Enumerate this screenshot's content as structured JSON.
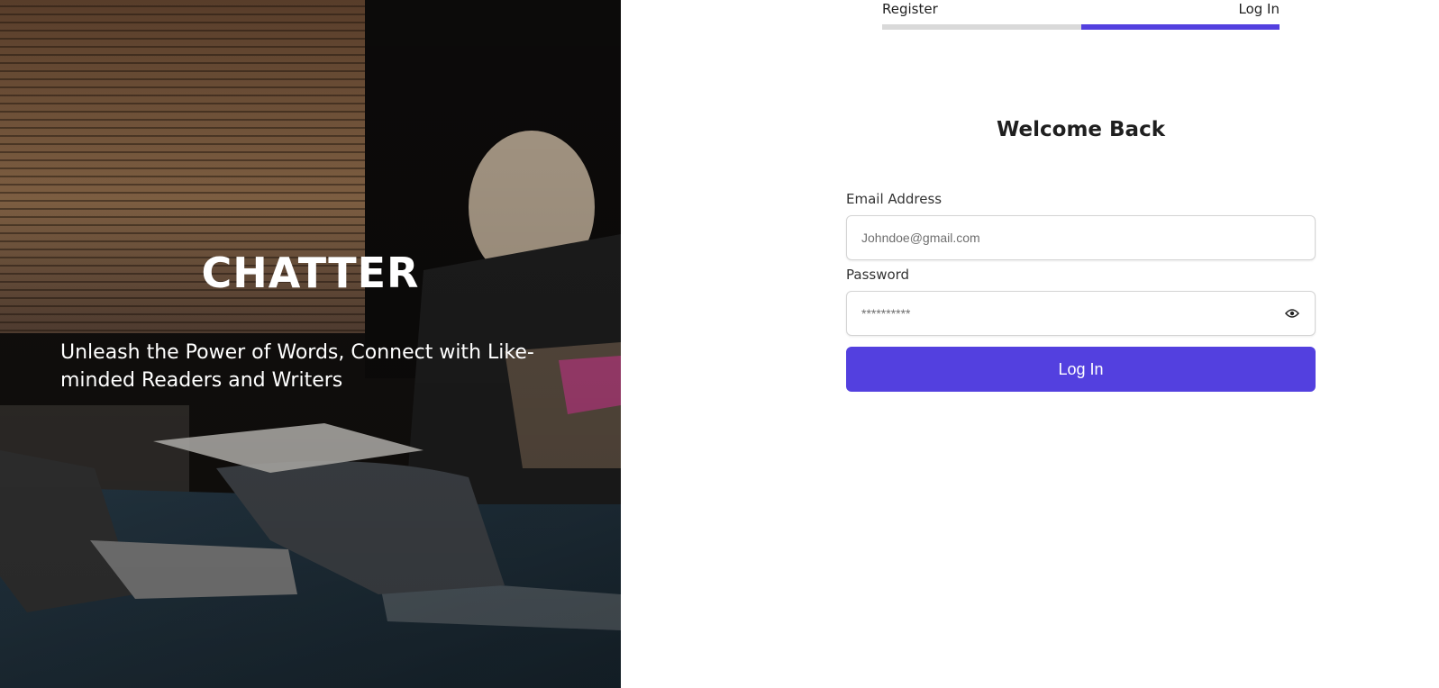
{
  "hero": {
    "brand": "CHATTER",
    "tagline": "Unleash the Power of Words, Connect with Like-minded Readers and Writers"
  },
  "tabs": [
    {
      "label": "Register",
      "active": false
    },
    {
      "label": "Log In",
      "active": true
    }
  ],
  "form": {
    "heading": "Welcome Back",
    "email_label": "Email Address",
    "email_placeholder": "Johndoe@gmail.com",
    "password_label": "Password",
    "password_placeholder": "**********",
    "submit_label": "Log In",
    "password_toggle_icon": "eye-icon"
  },
  "colors": {
    "accent": "#5340df",
    "tab_inactive": "#d9d9d9"
  }
}
